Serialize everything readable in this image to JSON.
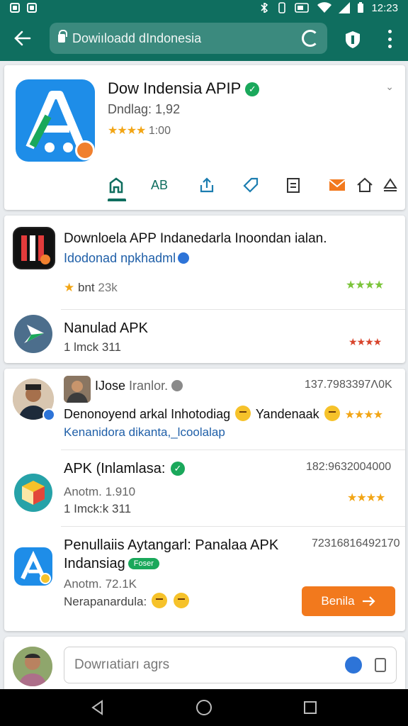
{
  "status_bar": {
    "time": "12:23"
  },
  "browser": {
    "url": "Dowiıloadd dIndonesia"
  },
  "hero": {
    "title": "Dow Indensia APIP",
    "downloads": "Dndlag: 1,92",
    "rating": "1:00",
    "tabs": [
      "AB"
    ]
  },
  "apps": [
    {
      "title": "Downloela APP Indanedarla Inoondan ialan.",
      "link": "Idodonad npkhadml",
      "meta": "bnt",
      "count": "23k"
    },
    {
      "title": "Nanulad APK",
      "meta": "1 lmck 311"
    }
  ],
  "reviews": [
    {
      "name": "IJose",
      "name_rest": "Iranlor.",
      "number": "137.7983397Λ0K",
      "text": "Denonoyend arkal Inhotodiag",
      "text2": "Yandenaak",
      "link": "Kenanidora dikanta,_lcoolalap"
    },
    {
      "title": "APK (Inlamlasa:",
      "number": "182:9632004000",
      "meta1": "Anotm. 1.910",
      "meta2": "1 Imck:k 311"
    },
    {
      "title": "Penullaiis Aytangarl: Panalaa APK",
      "title2": "Indansiag",
      "pill": "Foser",
      "number": "72316816492170",
      "meta1": "Anotm. 72.1K",
      "meta2": "Nerapanardula:",
      "cta": "Benila"
    }
  ],
  "comment": {
    "placeholder": "Dowrıatiarı agrs"
  },
  "colors": {
    "brand": "#0f6e5f",
    "accent": "#f2791d",
    "star": "#f2a515",
    "verified": "#1aa85b"
  }
}
